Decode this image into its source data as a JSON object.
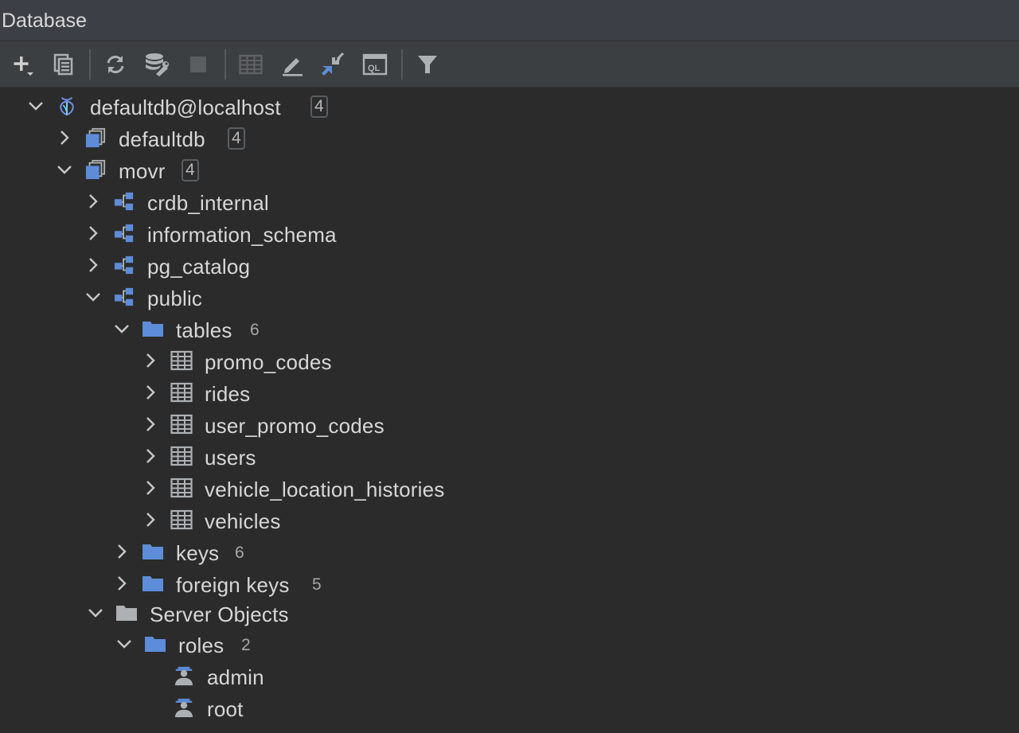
{
  "window": {
    "title": "Database"
  },
  "toolbar": {
    "buttons": [
      {
        "name": "add-icon"
      },
      {
        "name": "duplicate-icon"
      },
      {
        "name": "refresh-icon"
      },
      {
        "name": "data-source-properties-icon"
      },
      {
        "name": "stop-icon"
      },
      {
        "name": "table-editor-icon"
      },
      {
        "name": "edit-icon"
      },
      {
        "name": "jump-to-console-icon"
      },
      {
        "name": "sql-console-icon"
      },
      {
        "name": "filter-icon"
      }
    ]
  },
  "tree": {
    "root": {
      "label": "defaultdb@localhost",
      "count": "4"
    },
    "db_defaultdb": {
      "label": "defaultdb",
      "count": "4"
    },
    "db_movr": {
      "label": "movr",
      "count": "4"
    },
    "schemas": [
      "crdb_internal",
      "information_schema",
      "pg_catalog",
      "public"
    ],
    "tables_folder": {
      "label": "tables",
      "count": "6"
    },
    "tables": [
      "promo_codes",
      "rides",
      "user_promo_codes",
      "users",
      "vehicle_location_histories",
      "vehicles"
    ],
    "keys_folder": {
      "label": "keys",
      "count": "6"
    },
    "fkeys_folder": {
      "label": "foreign keys",
      "count": "5"
    },
    "server_objects": {
      "label": "Server Objects"
    },
    "roles_folder": {
      "label": "roles",
      "count": "2"
    },
    "roles": [
      "admin",
      "root"
    ]
  },
  "colors": {
    "accent_blue": "#5d8cd8",
    "icon_gray": "#aeb1b4",
    "background": "#2b2b2b",
    "toolbar": "#3c3f41"
  }
}
